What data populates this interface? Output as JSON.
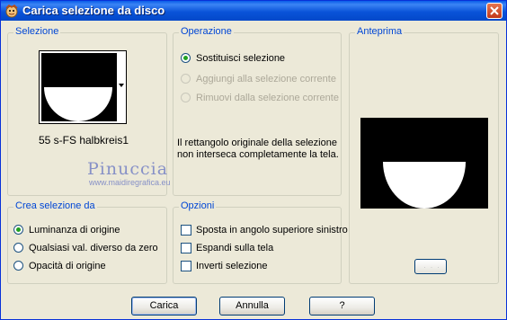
{
  "window": {
    "title": "Carica selezione da disco",
    "close_label": "close"
  },
  "selezione": {
    "title": "Selezione",
    "selected_name": "55 s-FS halbkreis1"
  },
  "operazione": {
    "title": "Operazione",
    "options": [
      {
        "label": "Sostituisci selezione",
        "checked": true,
        "disabled": false
      },
      {
        "label": "Aggiungi alla selezione corrente",
        "checked": false,
        "disabled": true
      },
      {
        "label": "Rimuovi dalla selezione corrente",
        "checked": false,
        "disabled": true
      }
    ],
    "info_line1": "Il rettangolo originale della selezione",
    "info_line2": "non interseca completamente la tela."
  },
  "anteprima": {
    "title": "Anteprima",
    "zoom_button": "· · ·"
  },
  "crea": {
    "title": "Crea selezione da",
    "options": [
      {
        "label": "Luminanza di origine",
        "checked": true
      },
      {
        "label": "Qualsiasi val. diverso da zero",
        "checked": false
      },
      {
        "label": "Opacità di origine",
        "checked": false
      }
    ]
  },
  "opzioni": {
    "title": "Opzioni",
    "options": [
      {
        "label": "Sposta in angolo superiore sinistro",
        "checked": false
      },
      {
        "label": "Espandi sulla tela",
        "checked": false
      },
      {
        "label": "Inverti selezione",
        "checked": false
      }
    ]
  },
  "buttons": {
    "load": "Carica",
    "cancel": "Annulla",
    "help": "?"
  },
  "watermark": {
    "name": "Pinuccia",
    "url": "www.maidiregrafica.eu"
  },
  "colors": {
    "group_title": "#0046d5",
    "titlebar": "#0a54d9",
    "window_bg": "#ece9d8"
  }
}
